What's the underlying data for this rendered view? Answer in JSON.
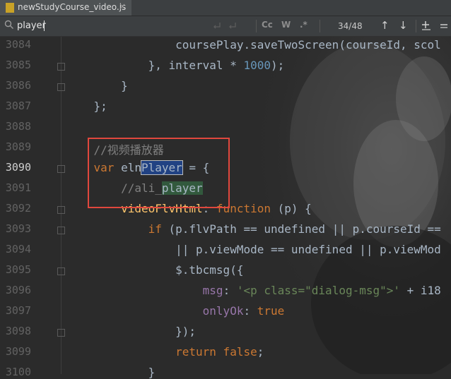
{
  "tab": {
    "filename": "newStudyCourse_video.js",
    "close": "×"
  },
  "search": {
    "query": "player",
    "buttons": {
      "match_case": "Cc",
      "words": "W",
      "regex": ".*"
    },
    "match_count": "34/48",
    "prev": "↑",
    "next": "↓"
  },
  "lines": [
    {
      "no": "3084",
      "pre": "                ",
      "parts": [
        [
          "",
          "coursePlay.saveTwoScreen(courseId, scol"
        ]
      ]
    },
    {
      "no": "3085",
      "pre": "            ",
      "parts": [
        [
          "",
          "}, interval * "
        ],
        [
          "n",
          "1000"
        ],
        [
          "",
          ");"
        ]
      ]
    },
    {
      "no": "3086",
      "pre": "        ",
      "parts": [
        [
          "",
          "}"
        ]
      ]
    },
    {
      "no": "3087",
      "pre": "    ",
      "parts": [
        [
          "",
          "};"
        ]
      ]
    },
    {
      "no": "3088",
      "pre": "",
      "parts": []
    },
    {
      "no": "3089",
      "pre": "    ",
      "parts": [
        [
          "c",
          "//视频播放器"
        ]
      ]
    },
    {
      "no": "3090",
      "pre": "    ",
      "parts": [
        [
          "k",
          "var "
        ],
        [
          "",
          "eln"
        ],
        [
          "sel",
          "Player"
        ],
        [
          "",
          " = {"
        ]
      ]
    },
    {
      "no": "3091",
      "pre": "        ",
      "parts": [
        [
          "c",
          "//ali_"
        ],
        [
          "find",
          "player"
        ]
      ]
    },
    {
      "no": "3092",
      "pre": "        ",
      "parts": [
        [
          "f",
          "videoFlvHtml"
        ],
        [
          "",
          ": "
        ],
        [
          "k",
          "function "
        ],
        [
          "",
          "(p) {"
        ]
      ]
    },
    {
      "no": "3093",
      "pre": "            ",
      "parts": [
        [
          "k",
          "if "
        ],
        [
          "",
          "(p.flvPath == undefined || p.courseId =="
        ]
      ]
    },
    {
      "no": "3094",
      "pre": "                ",
      "parts": [
        [
          "",
          "|| p.viewMode == undefined || p.viewMod"
        ]
      ]
    },
    {
      "no": "3095",
      "pre": "                ",
      "parts": [
        [
          "",
          "$.tbcmsg({"
        ]
      ]
    },
    {
      "no": "3096",
      "pre": "                    ",
      "parts": [
        [
          "p",
          "msg"
        ],
        [
          "",
          ": "
        ],
        [
          "s",
          "'<p class=\"dialog-msg\">'"
        ],
        [
          "",
          " + i18"
        ]
      ]
    },
    {
      "no": "3097",
      "pre": "                    ",
      "parts": [
        [
          "p",
          "onlyOk"
        ],
        [
          "",
          ": "
        ],
        [
          "k",
          "true"
        ]
      ]
    },
    {
      "no": "3098",
      "pre": "                ",
      "parts": [
        [
          "",
          "});"
        ]
      ]
    },
    {
      "no": "3099",
      "pre": "                ",
      "parts": [
        [
          "k",
          "return false"
        ],
        [
          "",
          ";"
        ]
      ]
    },
    {
      "no": "3100",
      "pre": "            ",
      "parts": [
        [
          "",
          "}"
        ]
      ]
    }
  ]
}
